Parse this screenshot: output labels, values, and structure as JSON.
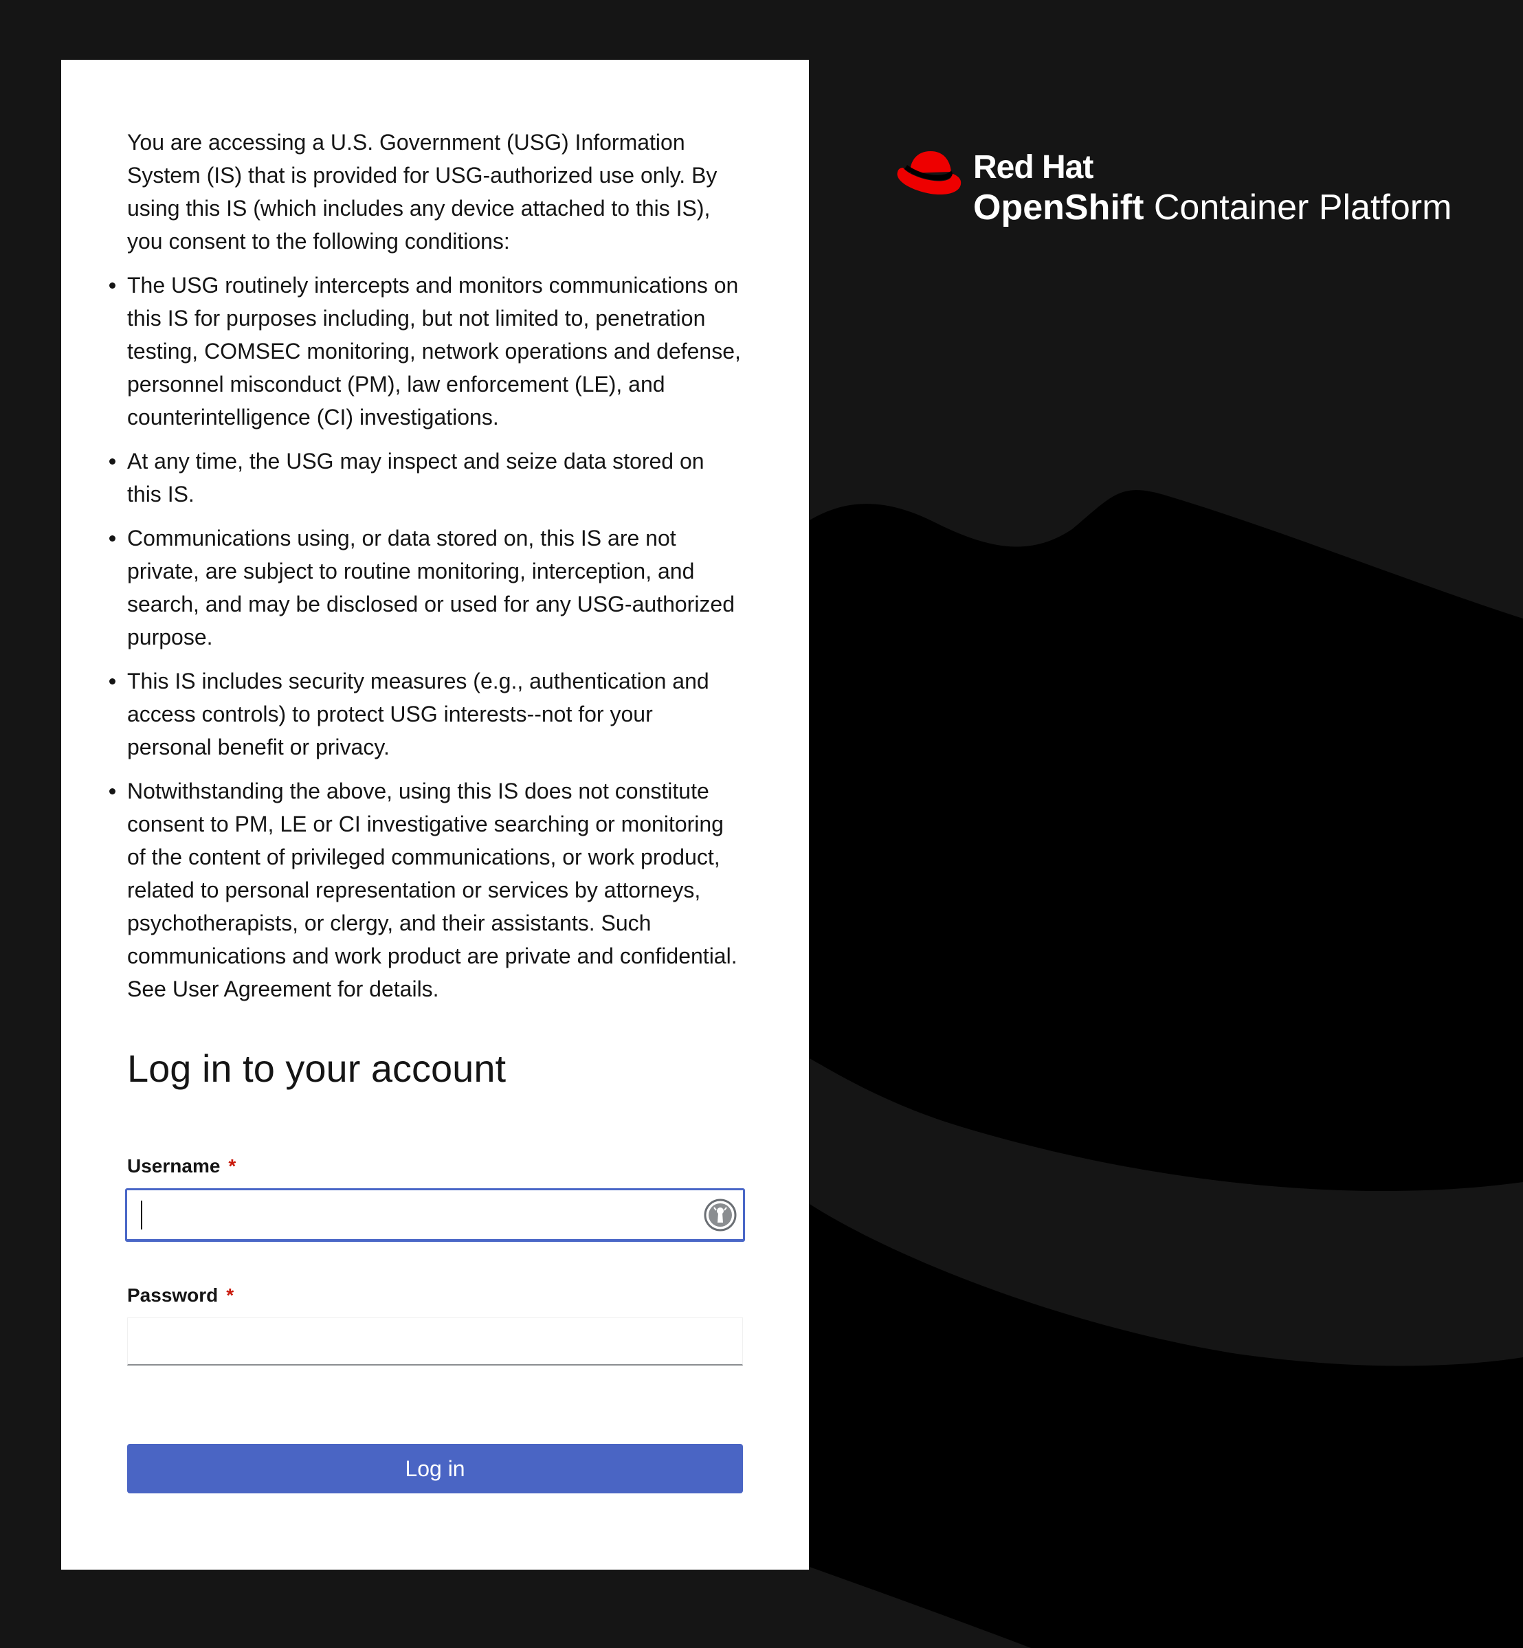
{
  "notice": {
    "intro": "You are accessing a U.S. Government (USG) Information System (IS) that is provided for USG-authorized use only. By using this IS (which includes any device attached to this IS), you consent to the following conditions:",
    "items": [
      "The USG routinely intercepts and monitors communications on this IS for purposes including, but not limited to, penetration testing, COMSEC monitoring, network operations and defense, personnel misconduct (PM), law enforcement (LE), and counterintelligence (CI) investigations.",
      "At any time, the USG may inspect and seize data stored on this IS.",
      "Communications using, or data stored on, this IS are not private, are subject to routine monitoring, interception, and search, and may be disclosed or used for any USG-authorized purpose.",
      "This IS includes security measures (e.g., authentication and access controls) to protect USG interests--not for your personal benefit or privacy.",
      "Notwithstanding the above, using this IS does not constitute consent to PM, LE or CI investigative searching or monitoring of the content of privileged communications, or work product, related to personal representation or services by attorneys, psychotherapists, or clergy, and their assistants. Such communications and work product are private and confidential. See User Agreement for details."
    ]
  },
  "login": {
    "title": "Log in to your account",
    "username_label": "Username",
    "password_label": "Password",
    "required_mark": "*",
    "username_value": "",
    "password_value": "",
    "submit_label": "Log in"
  },
  "brand": {
    "company": "Red Hat",
    "product_bold": "OpenShift",
    "product_rest": " Container Platform"
  },
  "icons": {
    "brand_logo": "red-hat-fedora-icon",
    "password_manager": "keyhole-icon"
  },
  "colors": {
    "page_background": "#151515",
    "card_background": "#ffffff",
    "primary_button": "#4a65c4",
    "focus_border": "#4a67c7",
    "required_mark": "#c9190b",
    "brand_red": "#ee0000"
  }
}
